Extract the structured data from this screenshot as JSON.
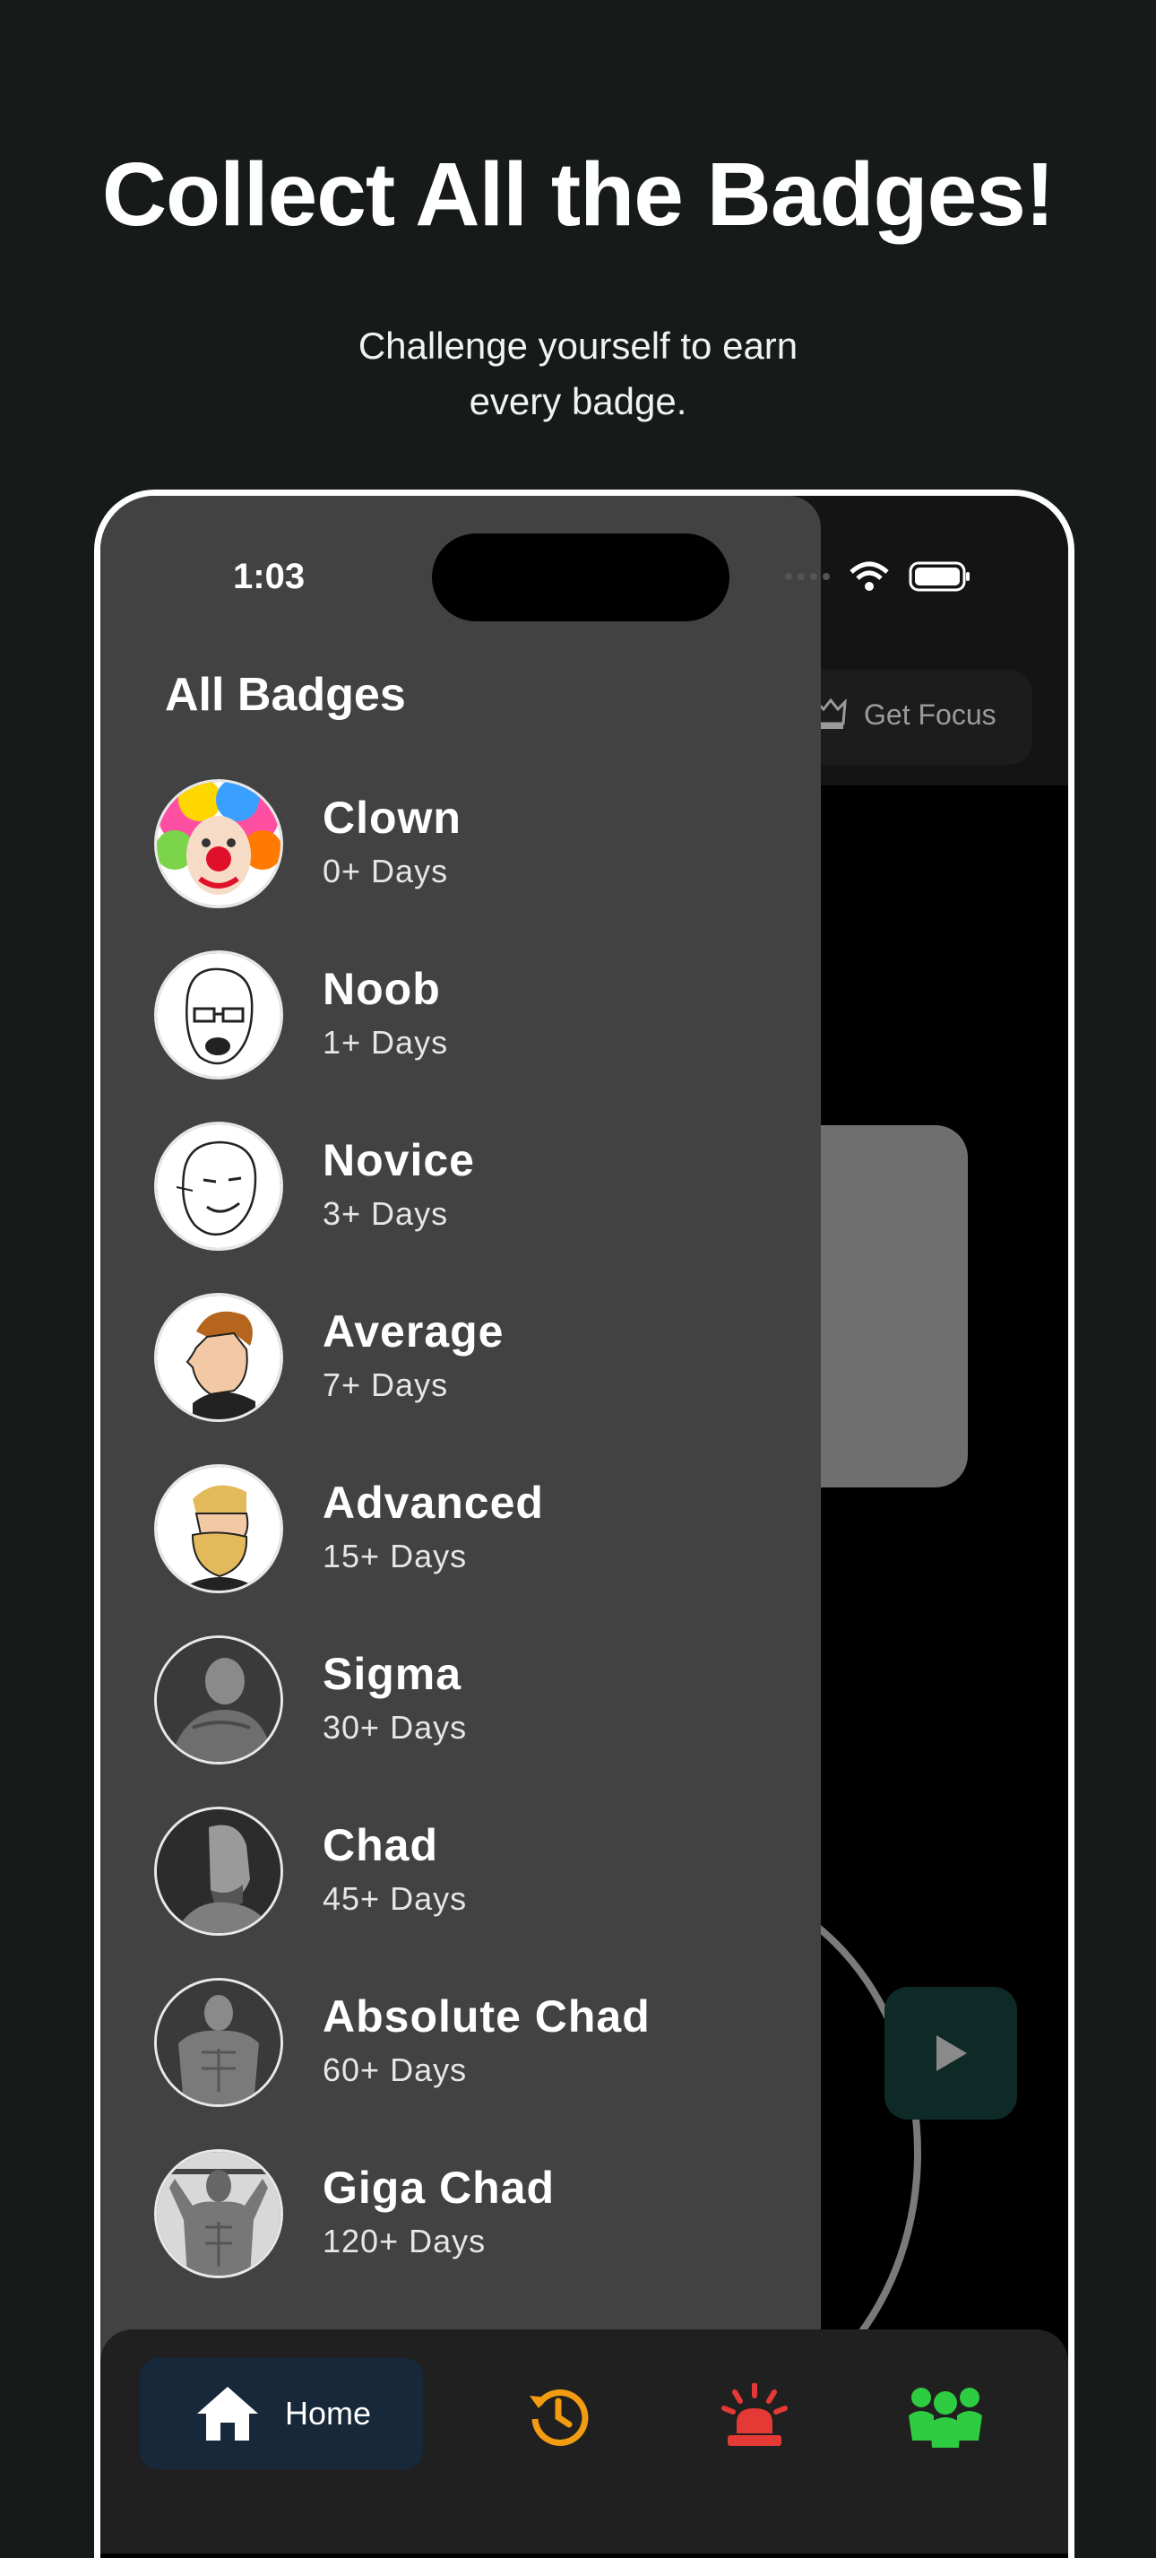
{
  "promo": {
    "headline": "Collect All the Badges!",
    "subline": "Challenge yourself to earn every badge."
  },
  "status_bar": {
    "time": "1:03"
  },
  "topbar": {
    "focus_label": "Get Focus"
  },
  "drawer": {
    "title": "All Badges",
    "badges": [
      {
        "name": "Clown",
        "days": "0+ Days",
        "icon": "clown-avatar"
      },
      {
        "name": "Noob",
        "days": "1+ Days",
        "icon": "noob-avatar"
      },
      {
        "name": "Novice",
        "days": "3+ Days",
        "icon": "novice-avatar"
      },
      {
        "name": "Average",
        "days": "7+ Days",
        "icon": "average-avatar"
      },
      {
        "name": "Advanced",
        "days": "15+ Days",
        "icon": "advanced-avatar"
      },
      {
        "name": "Sigma",
        "days": "30+ Days",
        "icon": "sigma-avatar"
      },
      {
        "name": "Chad",
        "days": "45+ Days",
        "icon": "chad-avatar"
      },
      {
        "name": "Absolute Chad",
        "days": "60+ Days",
        "icon": "absolute-chad-avatar"
      },
      {
        "name": "Giga Chad",
        "days": "120+ Days",
        "icon": "giga-chad-avatar"
      }
    ]
  },
  "nav": {
    "home_label": "Home",
    "items": [
      "home-icon",
      "history-icon",
      "alarm-icon",
      "community-icon"
    ]
  },
  "colors": {
    "page_bg": "#161b19",
    "drawer_bg": "#424242",
    "nav_active_bg": "#16283a",
    "history": "#f39c12",
    "alarm": "#e53935",
    "community": "#2ecc40"
  }
}
